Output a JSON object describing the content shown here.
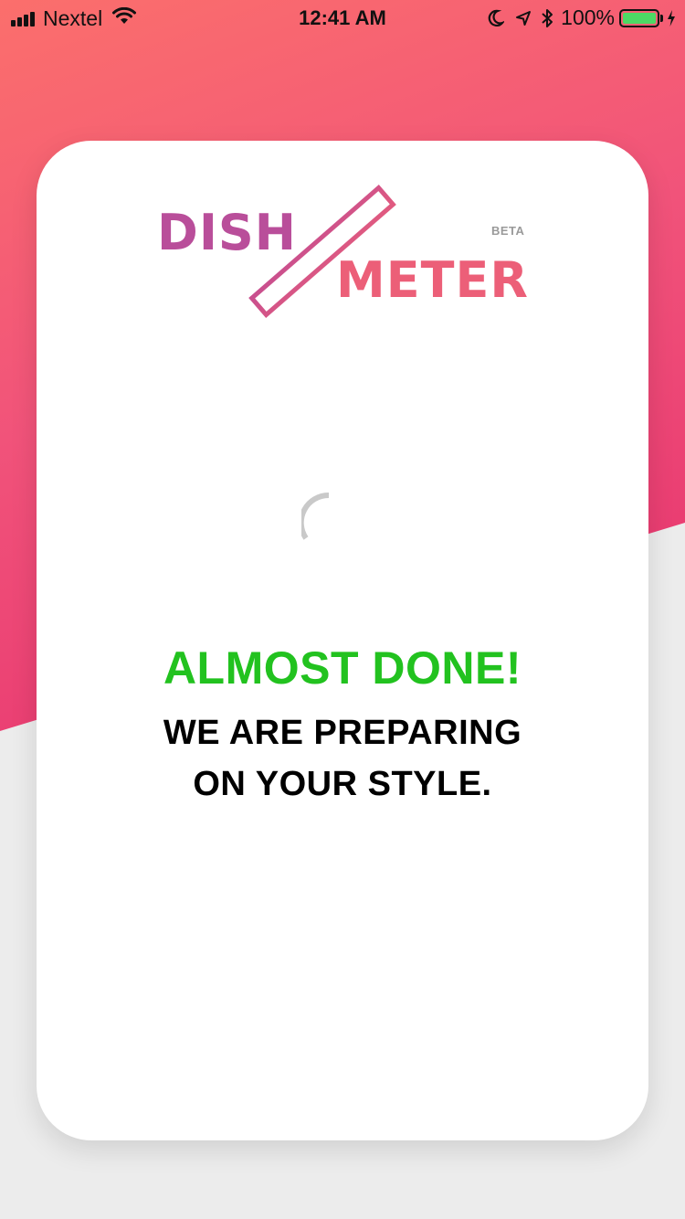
{
  "status_bar": {
    "carrier": "Nextel",
    "time": "12:41 AM",
    "battery_percent": "100%",
    "battery_level": 1.0,
    "battery_color": "#4cd964",
    "signal_bars": 4,
    "icons": [
      "signal-icon",
      "wifi-icon",
      "moon-icon",
      "location-arrow-icon",
      "bluetooth-icon",
      "battery-icon",
      "charging-bolt-icon"
    ]
  },
  "logo": {
    "word1": "DISH",
    "word2": "METER",
    "badge": "BETA",
    "word1_color": "#b94e9a",
    "word2_color": "#ec5f78",
    "icon": "ruler-icon"
  },
  "loading": {
    "spinner": "loading-spinner-icon",
    "headline": "ALMOST DONE!",
    "headline_color": "#22c21f",
    "message_line1": "WE ARE PREPARING",
    "message_line2": "ON YOUR STYLE."
  },
  "colors": {
    "gradient_start": "#fb6f6c",
    "gradient_end": "#dd1d6f",
    "background": "#ececec",
    "card": "#ffffff"
  }
}
